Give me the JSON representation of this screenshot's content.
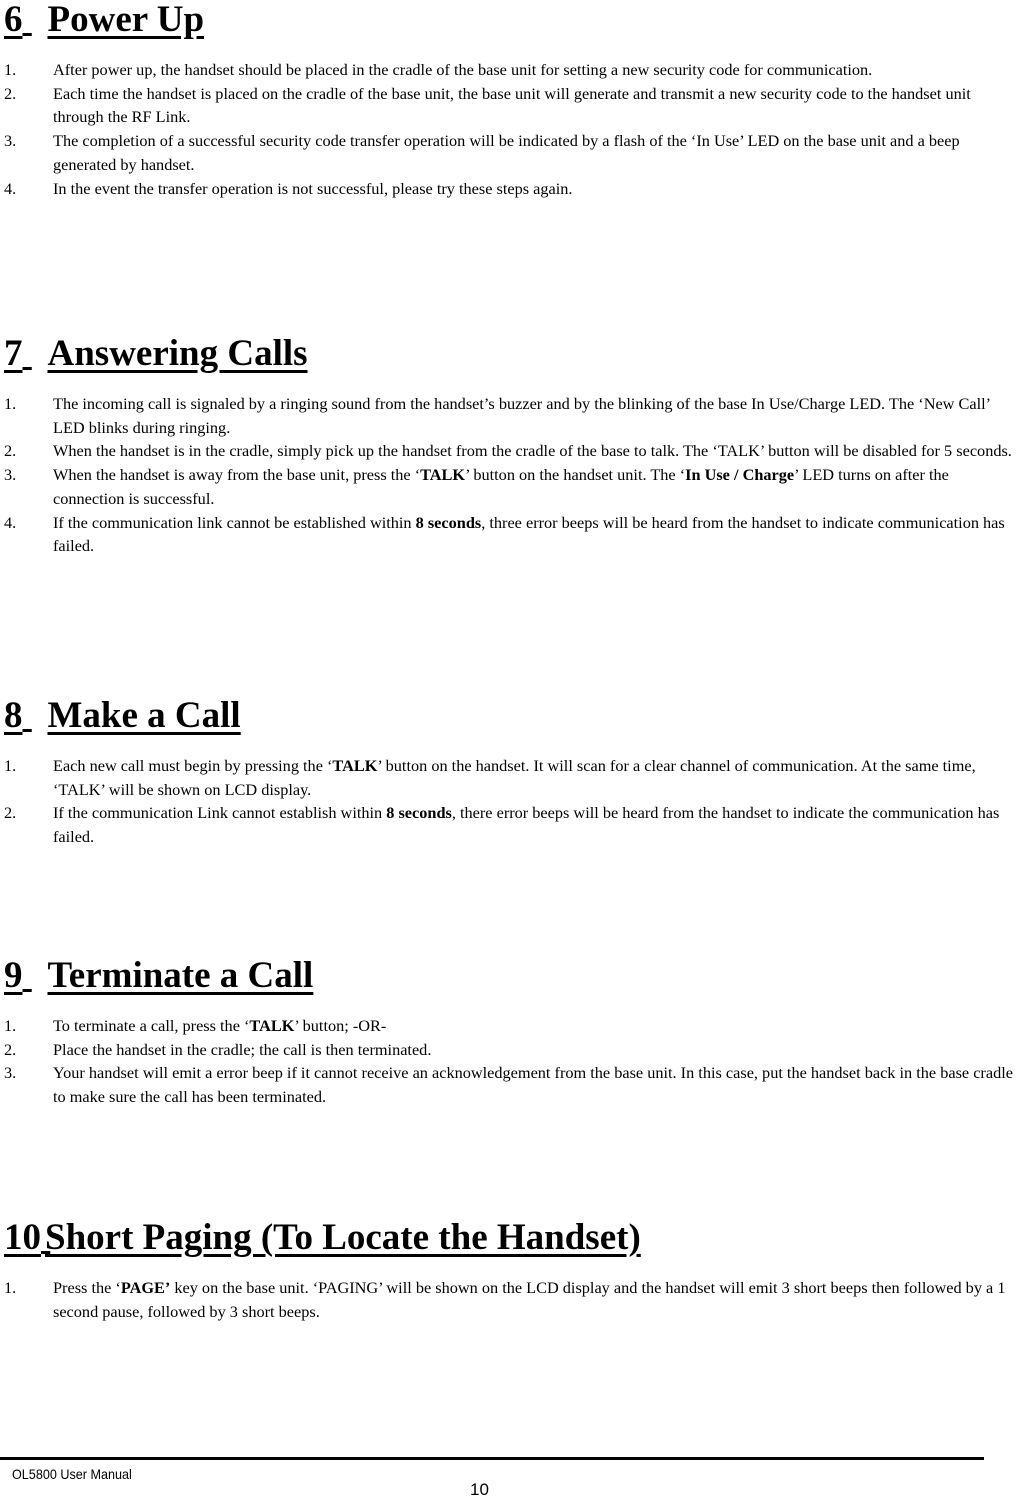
{
  "sections": [
    {
      "number": "6",
      "title": "Power Up",
      "items": [
        {
          "idx": "1.",
          "parts": [
            {
              "t": "After power up, the handset should be placed in the cradle of the base unit for setting a new security code for communication."
            }
          ]
        },
        {
          "idx": "2.",
          "parts": [
            {
              "t": "Each time the handset is placed on the cradle of the base unit, the base unit will generate and transmit a new security code to the handset unit through the RF Link."
            }
          ]
        },
        {
          "idx": "3.",
          "parts": [
            {
              "t": "The completion of a successful security code transfer operation will be indicated by a flash of the ‘In Use’ LED on the base unit and a beep generated by handset."
            }
          ]
        },
        {
          "idx": "4.",
          "parts": [
            {
              "t": "In the event the transfer operation is not successful, please try these steps again."
            }
          ]
        }
      ]
    },
    {
      "number": "7",
      "title": "Answering Calls",
      "items": [
        {
          "idx": "1.",
          "parts": [
            {
              "t": "The incoming call is signaled by a ringing sound from the handset’s buzzer and by the blinking of the base In Use/Charge LED.  The ‘New Call’ LED blinks during ringing."
            }
          ]
        },
        {
          "idx": "2.",
          "parts": [
            {
              "t": "When the handset is in the cradle, simply pick up the handset from the cradle of the base to talk. The ‘TALK’ button will be disabled for 5 seconds."
            }
          ]
        },
        {
          "idx": "3.",
          "parts": [
            {
              "t": "When the handset is away from the base unit, press the ‘"
            },
            {
              "t": "TALK",
              "b": true
            },
            {
              "t": "’ button on the handset unit. The ‘"
            },
            {
              "t": "In Use / Charge",
              "b": true
            },
            {
              "t": "’ LED turns on after the connection is successful."
            }
          ]
        },
        {
          "idx": "4.",
          "parts": [
            {
              "t": "If the communication link cannot be established within "
            },
            {
              "t": "8 seconds",
              "b": true
            },
            {
              "t": ", three error beeps will be heard from the handset to indicate communication has failed."
            }
          ]
        }
      ]
    },
    {
      "number": "8",
      "title": "Make a Call",
      "items": [
        {
          "idx": "1.",
          "parts": [
            {
              "t": "Each new call must begin by pressing the ‘"
            },
            {
              "t": "TALK",
              "b": true
            },
            {
              "t": "’ button on the handset. It will scan for a clear channel of communication. At the same time, ‘TALK’ will be shown on LCD display."
            }
          ]
        },
        {
          "idx": "2.",
          "parts": [
            {
              "t": "If the communication Link cannot establish within "
            },
            {
              "t": "8 seconds",
              "b": true
            },
            {
              "t": ", there error beeps will be heard from the handset to indicate the communication has failed."
            }
          ]
        }
      ]
    },
    {
      "number": "9",
      "title": "Terminate a Call",
      "items": [
        {
          "idx": "1.",
          "parts": [
            {
              "t": "To terminate a call, press the ‘"
            },
            {
              "t": "TALK",
              "b": true
            },
            {
              "t": "’ button;            -OR-"
            }
          ]
        },
        {
          "idx": "2.",
          "parts": [
            {
              "t": "Place the handset in the cradle; the call is then terminated."
            }
          ]
        },
        {
          "idx": "3.",
          "parts": [
            {
              "t": "Your handset will emit a error beep if it cannot receive an acknowledgement from the base unit. In this case, put the handset back in the base cradle to make sure the call has been terminated."
            }
          ]
        }
      ]
    },
    {
      "number": "10",
      "title": "Short Paging (To Locate the Handset)",
      "items": [
        {
          "idx": "1.",
          "parts": [
            {
              "t": "Press the ‘"
            },
            {
              "t": "PAGE’",
              "b": true
            },
            {
              "t": " key on the base unit. ‘PAGING’ will be shown on the LCD display and the handset will emit 3 short beeps then followed by a 1 second pause, followed by 3 short beeps."
            }
          ]
        }
      ]
    }
  ],
  "footer": {
    "manual_title": "OL5800 User Manual",
    "page_number": "10"
  }
}
